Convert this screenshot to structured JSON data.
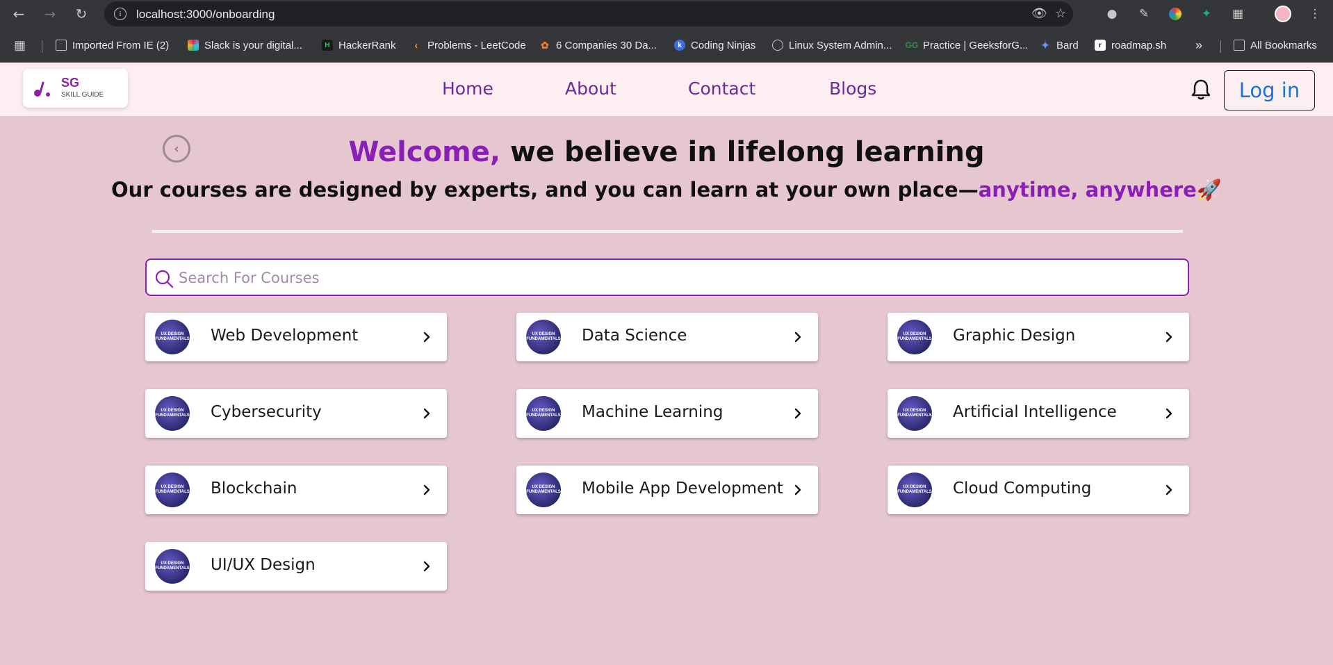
{
  "browser": {
    "url": "localhost:3000/onboarding",
    "bookmarks": [
      "Imported From IE (2)",
      "Slack is your digital...",
      "HackerRank",
      "Problems - LeetCode",
      "6 Companies 30 Da...",
      "Coding Ninjas",
      "Linux System Admin...",
      "Practice | GeeksforG...",
      "Bard",
      "roadmap.sh"
    ],
    "all_bookmarks": "All Bookmarks",
    "more": "»"
  },
  "header": {
    "logo_title": "SG",
    "logo_subtitle": "SKILL GUIDE",
    "nav": [
      "Home",
      "About",
      "Contact",
      "Blogs"
    ],
    "login_label": "Log in"
  },
  "hero": {
    "welcome": "Welcome,",
    "headline_rest": " we believe in lifelong learning",
    "subline_main": "Our courses are designed by experts, and you can learn at your own place—",
    "subline_accent": "anytime, anywhere",
    "subline_emoji": "🚀"
  },
  "search": {
    "placeholder": "Search For Courses",
    "value": ""
  },
  "courses": [
    "Web Development",
    "Data Science",
    "Graphic Design",
    "Cybersecurity",
    "Machine Learning",
    "Artificial Intelligence",
    "Blockchain",
    "Mobile App Development",
    "Cloud Computing",
    "UI/UX Design"
  ],
  "course_thumb_text": "UX DESIGN FUNDAMENTALS",
  "colors": {
    "accent": "#8a1fb8",
    "page_bg": "#e6c7cf",
    "header_bg": "#fdeef2",
    "login_text": "#1a73d9"
  }
}
